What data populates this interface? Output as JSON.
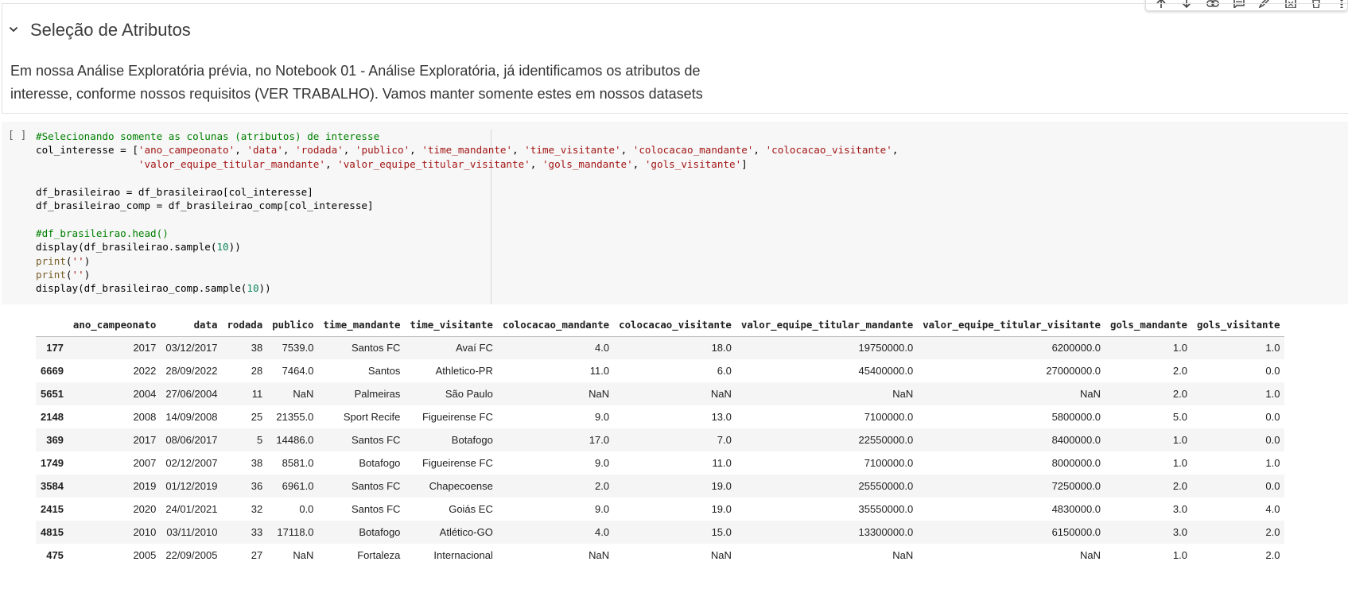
{
  "toolbar": {
    "icons": [
      "arrow-up-icon",
      "arrow-down-icon",
      "link-icon",
      "comment-icon",
      "pencil-icon",
      "mirror-cell-icon",
      "trash-icon",
      "more-vert-icon"
    ]
  },
  "text_cell": {
    "heading": "Seleção de Atributos",
    "paragraph_line1": "Em nossa Análise Exploratória prévia, no Notebook 01 - Análise Exploratória, já identificamos os atributos de",
    "paragraph_line2": "interesse, conforme nossos requisitos (VER TRABALHO). Vamos manter somente estes em nossos datasets"
  },
  "code_cell": {
    "run_indicator": "[ ]",
    "comment1": "#Selecionando somente as colunas (atributos) de interesse",
    "line2_prefix": "col_interesse = [",
    "line2_strings": [
      "'ano_campeonato'",
      "'data'",
      "'rodada'",
      "'publico'",
      "'time_mandante'",
      "'time_visitante'",
      "'colocacao_mandante'",
      "'colocacao_visitante'"
    ],
    "line3_strings": [
      "'valor_equipe_titular_mandante'",
      "'valor_equipe_titular_visitante'",
      "'gols_mandante'",
      "'gols_visitante'"
    ],
    "line5": "df_brasileirao = df_brasileirao[col_interesse]",
    "line6": "df_brasileirao_comp = df_brasileirao_comp[col_interesse]",
    "comment2": "#df_brasileirao.head()",
    "display1_prefix": "display(df_brasileirao.sample(",
    "display1_num": "10",
    "display1_suffix": "))",
    "print_fn": "print",
    "print_arg": "''",
    "display2_prefix": "display(df_brasileirao_comp.sample(",
    "display2_num": "10",
    "display2_suffix": "))"
  },
  "output_table": {
    "columns": [
      "ano_campeonato",
      "data",
      "rodada",
      "publico",
      "time_mandante",
      "time_visitante",
      "colocacao_mandante",
      "colocacao_visitante",
      "valor_equipe_titular_mandante",
      "valor_equipe_titular_visitante",
      "gols_mandante",
      "gols_visitante"
    ],
    "rows": [
      {
        "index": "177",
        "cells": [
          "2017",
          "03/12/2017",
          "38",
          "7539.0",
          "Santos FC",
          "Avaí FC",
          "4.0",
          "18.0",
          "19750000.0",
          "6200000.0",
          "1.0",
          "1.0"
        ]
      },
      {
        "index": "6669",
        "cells": [
          "2022",
          "28/09/2022",
          "28",
          "7464.0",
          "Santos",
          "Athletico-PR",
          "11.0",
          "6.0",
          "45400000.0",
          "27000000.0",
          "2.0",
          "0.0"
        ]
      },
      {
        "index": "5651",
        "cells": [
          "2004",
          "27/06/2004",
          "11",
          "NaN",
          "Palmeiras",
          "São Paulo",
          "NaN",
          "NaN",
          "NaN",
          "NaN",
          "2.0",
          "1.0"
        ]
      },
      {
        "index": "2148",
        "cells": [
          "2008",
          "14/09/2008",
          "25",
          "21355.0",
          "Sport Recife",
          "Figueirense FC",
          "9.0",
          "13.0",
          "7100000.0",
          "5800000.0",
          "5.0",
          "0.0"
        ]
      },
      {
        "index": "369",
        "cells": [
          "2017",
          "08/06/2017",
          "5",
          "14486.0",
          "Santos FC",
          "Botafogo",
          "17.0",
          "7.0",
          "22550000.0",
          "8400000.0",
          "1.0",
          "0.0"
        ]
      },
      {
        "index": "1749",
        "cells": [
          "2007",
          "02/12/2007",
          "38",
          "8581.0",
          "Botafogo",
          "Figueirense FC",
          "9.0",
          "11.0",
          "7100000.0",
          "8000000.0",
          "1.0",
          "1.0"
        ]
      },
      {
        "index": "3584",
        "cells": [
          "2019",
          "01/12/2019",
          "36",
          "6961.0",
          "Santos FC",
          "Chapecoense",
          "2.0",
          "19.0",
          "25550000.0",
          "7250000.0",
          "2.0",
          "0.0"
        ]
      },
      {
        "index": "2415",
        "cells": [
          "2020",
          "24/01/2021",
          "32",
          "0.0",
          "Santos FC",
          "Goiás EC",
          "9.0",
          "19.0",
          "35550000.0",
          "4830000.0",
          "3.0",
          "4.0"
        ]
      },
      {
        "index": "4815",
        "cells": [
          "2010",
          "03/11/2010",
          "33",
          "17118.0",
          "Botafogo",
          "Atlético-GO",
          "4.0",
          "15.0",
          "13300000.0",
          "6150000.0",
          "3.0",
          "2.0"
        ]
      },
      {
        "index": "475",
        "cells": [
          "2005",
          "22/09/2005",
          "27",
          "NaN",
          "Fortaleza",
          "Internacional",
          "NaN",
          "NaN",
          "NaN",
          "NaN",
          "1.0",
          "2.0"
        ]
      }
    ]
  }
}
